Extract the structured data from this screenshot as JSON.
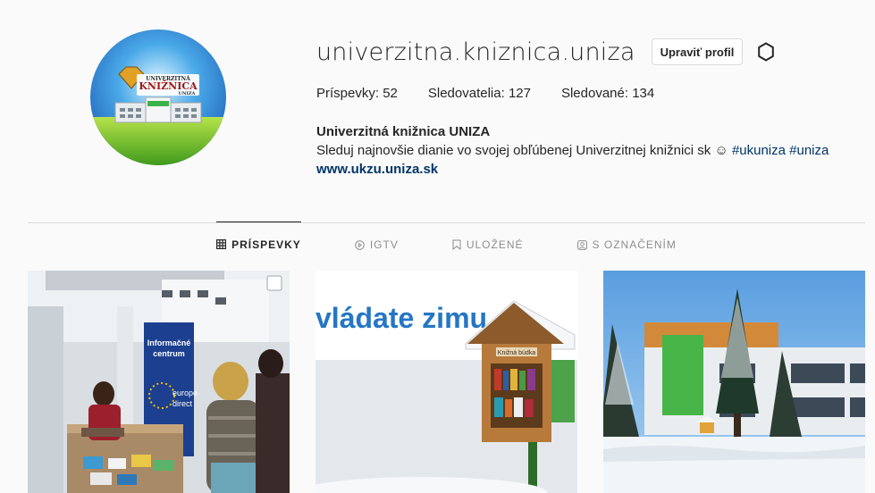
{
  "profile": {
    "username": "univerzitna.kniznica.uniza",
    "edit_label": "Upraviť profil",
    "avatar_text_top": "UNIVERZITNÁ",
    "avatar_text_main": "KNIŽNICA",
    "avatar_text_bottom": "UNIZA"
  },
  "stats": [
    {
      "label": "Príspevky: ",
      "value": "52"
    },
    {
      "label": "Sledovatelia: ",
      "value": "127"
    },
    {
      "label": "Sledované: ",
      "value": "134"
    }
  ],
  "bio": {
    "name": "Univerzitná knižnica UNIZA",
    "text": "Sleduj najnovšie dianie vo svojej obľúbenej Univerzitnej knižnici sk ☺ ",
    "hashtag1": "#ukuniza",
    "hashtag2": "#uniza",
    "link": "www.ukzu.uniza.sk"
  },
  "tabs": [
    {
      "label": "PRÍSPEVKY",
      "icon": "grid-icon",
      "active": true
    },
    {
      "label": "IGTV",
      "icon": "igtv-icon",
      "active": false
    },
    {
      "label": "ULOŽENÉ",
      "icon": "bookmark-icon",
      "active": false
    },
    {
      "label": "S OZNAČENÍM",
      "icon": "tagged-icon",
      "active": false
    }
  ],
  "posts": [
    {
      "banner": "Informačné",
      "banner2": "centrum",
      "sign": "europe",
      "sign2": "direct"
    },
    {
      "headline": "vládate zimu",
      "box_label": "Knižná búdka"
    },
    {
      "scene": "building-winter"
    }
  ],
  "colors": {
    "text": "#262626",
    "secondary": "#8e8e8e",
    "link": "#003569",
    "border": "#dbdbdb"
  }
}
